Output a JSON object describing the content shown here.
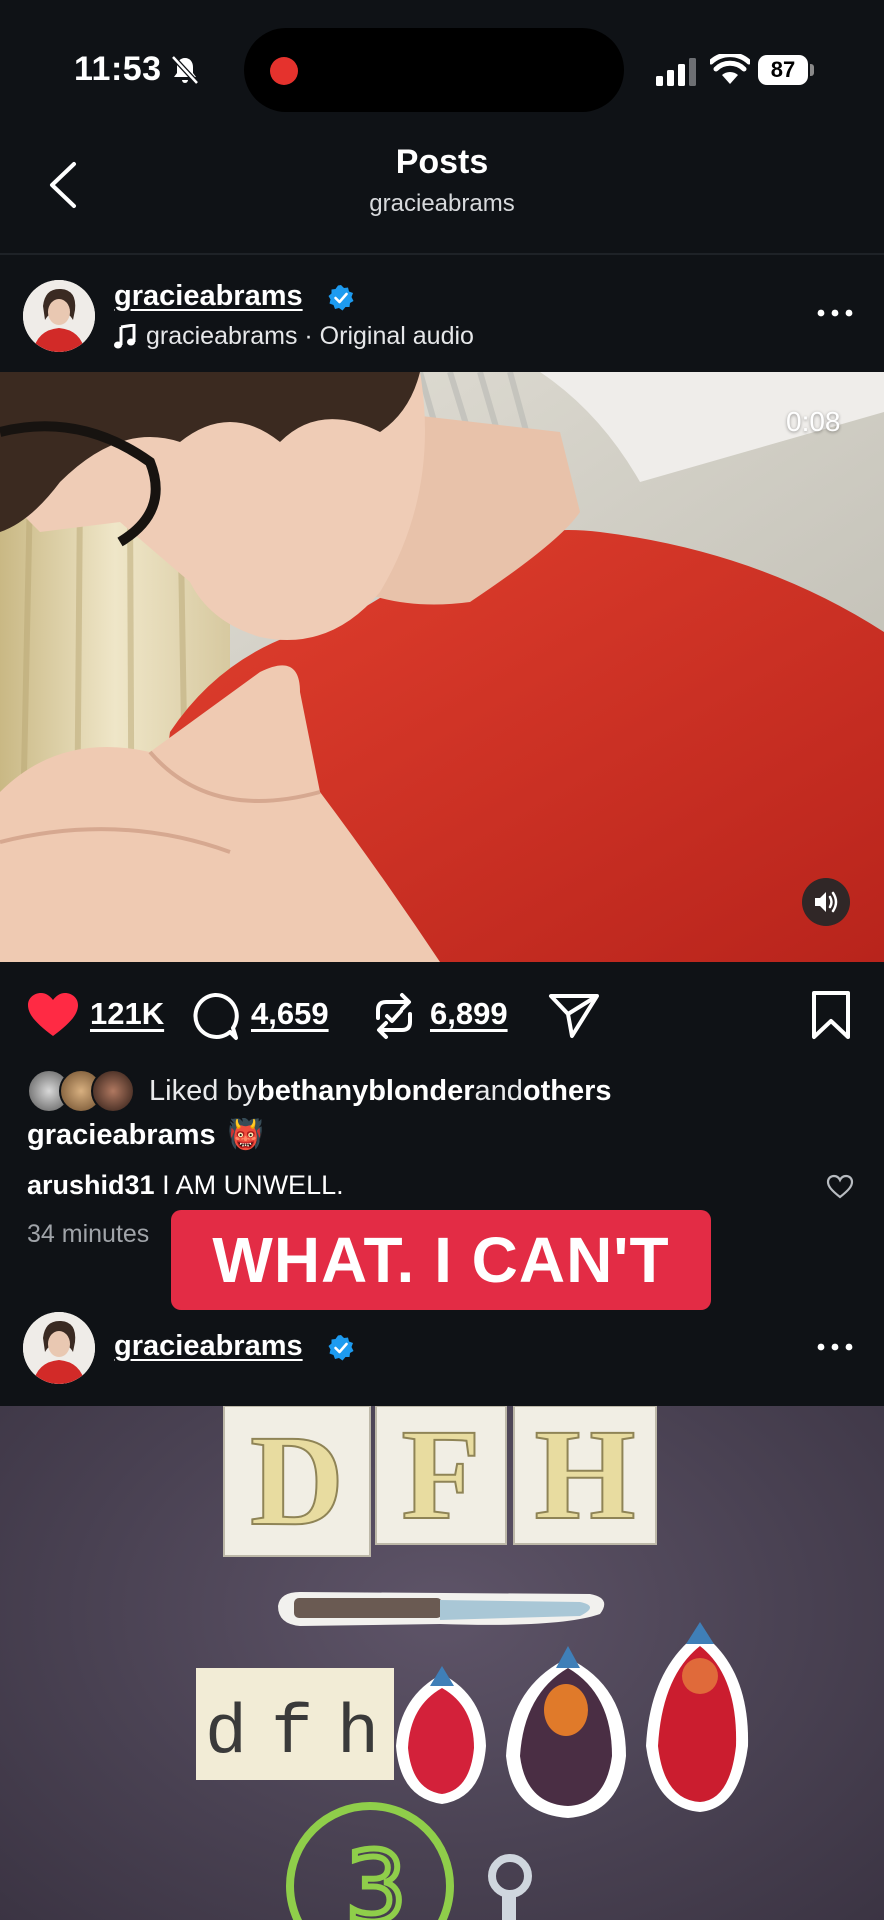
{
  "status_bar": {
    "time": "11:53",
    "battery": "87"
  },
  "header": {
    "title": "Posts",
    "subtitle": "gracieabrams"
  },
  "post1": {
    "username": "gracieabrams",
    "audio": "gracieabrams · Original audio",
    "video_timer": "0:08",
    "likes": "121K",
    "comments": "4,659",
    "reposts": "6,899",
    "liked_by_prefix": "Liked by ",
    "liked_by_user": "bethanyblonder",
    "liked_by_and": " and ",
    "liked_by_others": "others",
    "caption_user": "gracieabrams",
    "caption_emoji": "👹",
    "comment_user": "arushid31",
    "comment_text": " I AM UNWELL.",
    "time_ago": "34 minutes"
  },
  "overlay_caption": "WHAT. I CAN'T",
  "post2": {
    "username": "gracieabrams",
    "image_letters": [
      "D",
      "F",
      "H"
    ],
    "image_small_letters": [
      "d",
      "f",
      "h"
    ],
    "image_number": "3"
  },
  "colors": {
    "background": "#0f1216",
    "like_red": "#ff2a44",
    "verified_blue": "#1d9bf0",
    "overlay_red": "#e32c45"
  }
}
